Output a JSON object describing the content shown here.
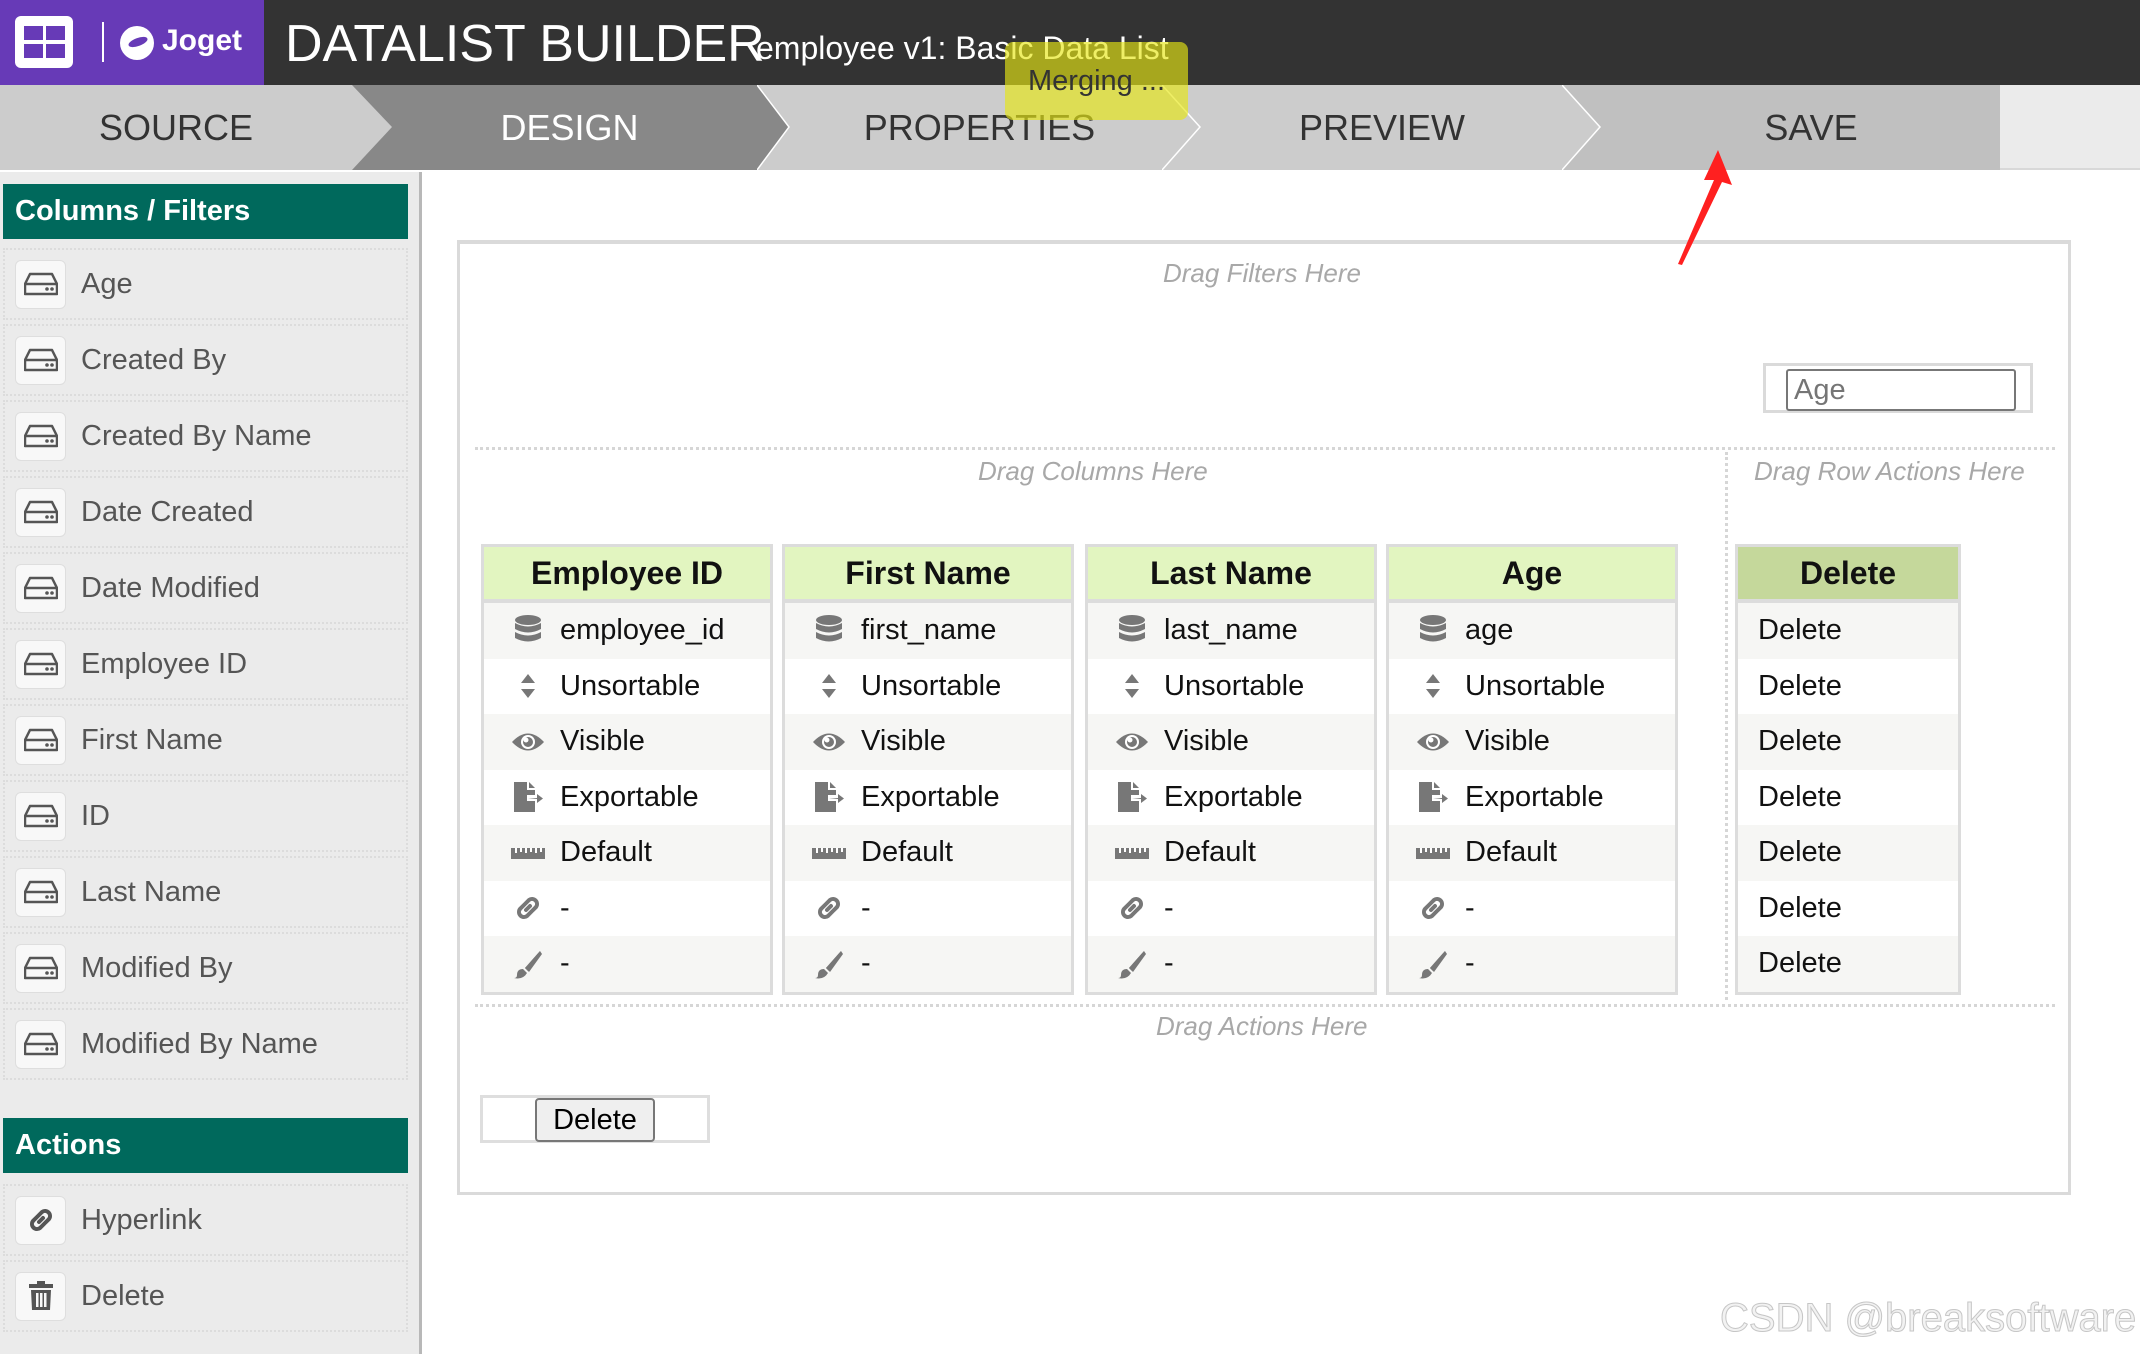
{
  "header": {
    "app_icon": "grid-icon",
    "brand": "Joget",
    "title": "DATALIST BUILDER",
    "subtitle": "employee v1: Basic Data List"
  },
  "tooltip": {
    "text": "Merging ..."
  },
  "tabs": [
    {
      "label": "SOURCE",
      "active": false
    },
    {
      "label": "DESIGN",
      "active": true
    },
    {
      "label": "PROPERTIES",
      "active": false
    },
    {
      "label": "PREVIEW",
      "active": false
    },
    {
      "label": "SAVE",
      "active": false
    }
  ],
  "sidebar": {
    "columns_header": "Columns / Filters",
    "columns": [
      {
        "label": "Age",
        "icon": "hdd-icon"
      },
      {
        "label": "Created By",
        "icon": "hdd-icon"
      },
      {
        "label": "Created By Name",
        "icon": "hdd-icon"
      },
      {
        "label": "Date Created",
        "icon": "hdd-icon"
      },
      {
        "label": "Date Modified",
        "icon": "hdd-icon"
      },
      {
        "label": "Employee ID",
        "icon": "hdd-icon"
      },
      {
        "label": "First Name",
        "icon": "hdd-icon"
      },
      {
        "label": "ID",
        "icon": "hdd-icon"
      },
      {
        "label": "Last Name",
        "icon": "hdd-icon"
      },
      {
        "label": "Modified By",
        "icon": "hdd-icon"
      },
      {
        "label": "Modified By Name",
        "icon": "hdd-icon"
      }
    ],
    "actions_header": "Actions",
    "actions": [
      {
        "label": "Hyperlink",
        "icon": "link-icon"
      },
      {
        "label": "Delete",
        "icon": "trash-icon"
      }
    ]
  },
  "canvas": {
    "filters_hint": "Drag Filters Here",
    "filter_placeholder": "Age",
    "columns_hint": "Drag Columns Here",
    "row_actions_hint": "Drag Row Actions Here",
    "actions_hint": "Drag Actions Here",
    "columns": [
      {
        "header": "Employee ID",
        "rows": [
          "employee_id",
          "Unsortable",
          "Visible",
          "Exportable",
          "Default",
          "-",
          "-"
        ]
      },
      {
        "header": "First Name",
        "rows": [
          "first_name",
          "Unsortable",
          "Visible",
          "Exportable",
          "Default",
          "-",
          "-"
        ]
      },
      {
        "header": "Last Name",
        "rows": [
          "last_name",
          "Unsortable",
          "Visible",
          "Exportable",
          "Default",
          "-",
          "-"
        ]
      },
      {
        "header": "Age",
        "rows": [
          "age",
          "Unsortable",
          "Visible",
          "Exportable",
          "Default",
          "-",
          "-"
        ]
      }
    ],
    "row_icons": [
      "database-icon",
      "sort-icon",
      "eye-icon",
      "export-icon",
      "ruler-icon",
      "link-icon",
      "paintbrush-icon"
    ],
    "row_action": {
      "header": "Delete",
      "rows": [
        "Delete",
        "Delete",
        "Delete",
        "Delete",
        "Delete",
        "Delete",
        "Delete"
      ]
    },
    "action_button": "Delete"
  },
  "colors": {
    "brand_purple": "#673ab7",
    "topbar": "#333333",
    "sidebar_header": "#00695c",
    "column_header": "#e2f5c0",
    "row_action_header": "#c5d89b",
    "tooltip": "#e6e614",
    "annotation_arrow": "#ff2020"
  },
  "watermark": "CSDN @breaksoftware"
}
